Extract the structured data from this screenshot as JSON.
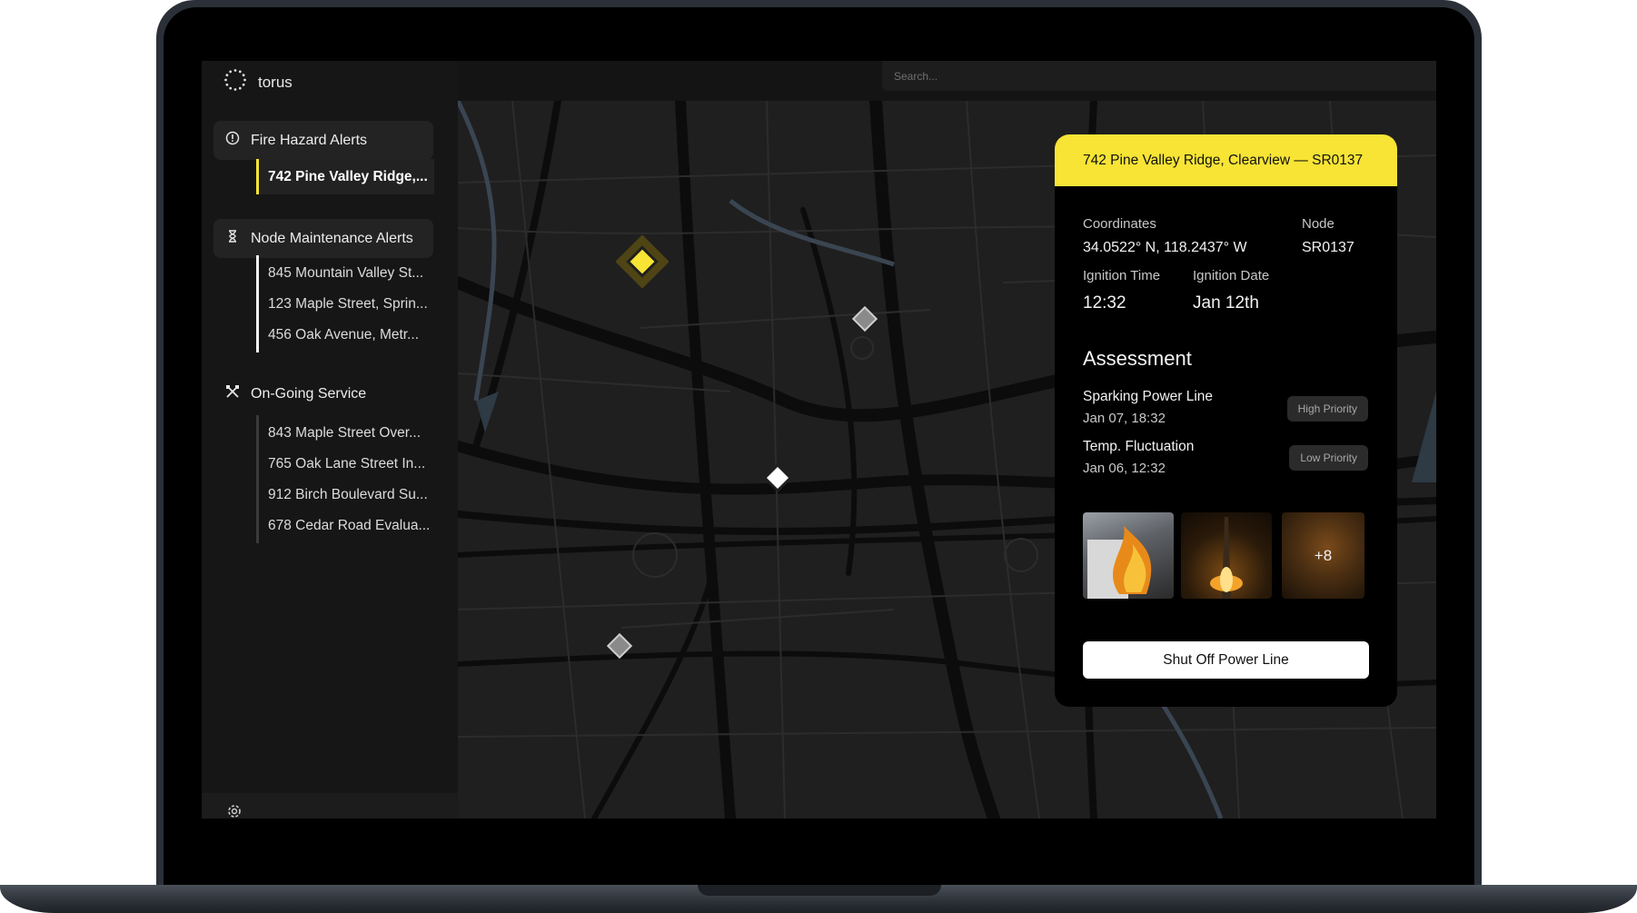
{
  "app": {
    "name": "torus"
  },
  "search": {
    "placeholder": "Search..."
  },
  "sidebar": {
    "fire": {
      "label": "Fire Hazard Alerts",
      "items": [
        "742 Pine Valley Ridge,..."
      ]
    },
    "node": {
      "label": "Node Maintenance Alerts",
      "items": [
        "845 Mountain Valley St...",
        "123 Maple Street, Sprin...",
        "456 Oak Avenue, Metr..."
      ]
    },
    "service": {
      "label": "On-Going Service",
      "items": [
        "843 Maple Street Over...",
        "765 Oak Lane Street In...",
        "912 Birch Boulevard Su...",
        "678 Cedar Road Evalua..."
      ]
    }
  },
  "panel": {
    "header": "742 Pine Valley Ridge, Clearview — SR0137",
    "coordinates_label": "Coordinates",
    "coordinates_value": "34.0522° N, 118.2437° W",
    "node_label": "Node",
    "node_value": "SR0137",
    "ignition_time_label": "Ignition Time",
    "ignition_time_value": "12:32",
    "ignition_date_label": "Ignition Date",
    "ignition_date_value": "Jan 12th",
    "assessment_title": "Assessment",
    "assessments": [
      {
        "title": "Sparking Power Line",
        "date": "Jan 07, 18:32",
        "priority": "High Priority"
      },
      {
        "title": "Temp. Fluctuation",
        "date": "Jan 06, 12:32",
        "priority": "Low Priority"
      }
    ],
    "more_photos": "+8",
    "action_button": "Shut Off Power Line"
  },
  "colors": {
    "accent": "#f7e435",
    "background": "#161616",
    "map": "#1f1f1f",
    "panel": "#000000"
  },
  "icons": [
    "torus-logo-icon",
    "search-icon",
    "bell-icon",
    "alert-circle-icon",
    "hourglass-icon",
    "tools-icon",
    "settings-icon",
    "map-marker-icon"
  ]
}
